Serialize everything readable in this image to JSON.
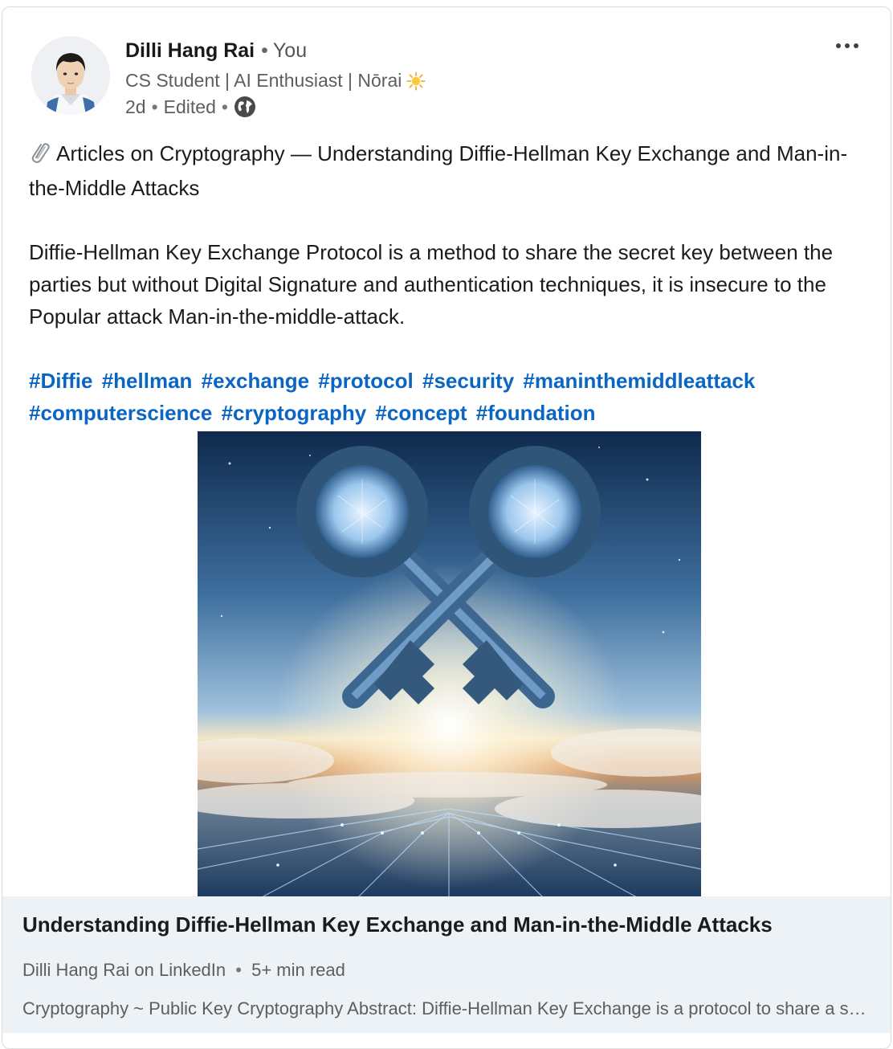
{
  "post": {
    "actor": {
      "name": "Dilli Hang Rai",
      "you_label": "You",
      "headline": "CS Student | AI Enthusiast | Nōrai",
      "time": "2d",
      "edited": "Edited"
    },
    "body": {
      "title_line": "Articles on Cryptography — Understanding Diffie-Hellman Key Exchange and Man-in-the-Middle Attacks",
      "paragraph": "Diffie-Hellman Key Exchange Protocol is a method to share the secret key between the parties but without Digital Signature and authentication techniques, it is insecure to the Popular attack Man-in-the-middle-attack.",
      "hashtags": [
        "#Diffie",
        "#hellman",
        "#exchange",
        "#protocol",
        "#security",
        "#maninthemiddleattack",
        "#computerscience",
        "#cryptography",
        "#concept",
        "#foundation"
      ]
    },
    "article": {
      "title": "Understanding Diffie-Hellman Key Exchange and Man-in-the-Middle Attacks",
      "source": "Dilli Hang Rai on LinkedIn",
      "read_time": "5+ min read",
      "description": "Cryptography ~ Public Key Cryptography Abstract: Diffie-Hellman Key Exchange is a protocol to share a secret key between two parties"
    },
    "icons": {
      "more": "more-horizontal-icon",
      "visibility": "globe-icon",
      "paperclip": "paperclip-icon",
      "sun": "sun-emoji-icon"
    },
    "colors": {
      "link": "#0a66c2",
      "text": "#191919",
      "muted": "#5e5e5e",
      "card_bg": "#edf2f6"
    }
  }
}
